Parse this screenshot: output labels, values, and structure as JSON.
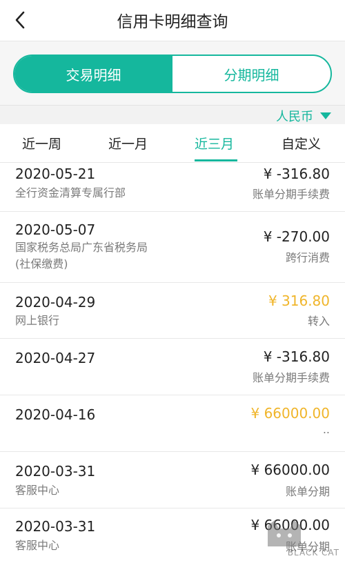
{
  "header": {
    "title": "信用卡明细查询",
    "back_icon": "back-arrow-icon"
  },
  "segments": [
    {
      "label": "交易明细",
      "active": true
    },
    {
      "label": "分期明细",
      "active": false
    }
  ],
  "currency": {
    "label": "人民币",
    "icon": "caret-down-icon"
  },
  "tabs": [
    {
      "label": "近一周",
      "active": false
    },
    {
      "label": "近一月",
      "active": false
    },
    {
      "label": "近三月",
      "active": true
    },
    {
      "label": "自定义",
      "active": false
    }
  ],
  "transactions": [
    {
      "date": "2020-05-21",
      "desc": "全行资金清算专属行部",
      "amount": "¥ -316.80",
      "type": "账单分期手续费"
    },
    {
      "date": "2020-05-07",
      "desc": "国家税务总局广东省税务局\n(社保缴费)",
      "amount": "¥ -270.00",
      "type": "跨行消费"
    },
    {
      "date": "2020-04-29",
      "desc": "网上银行",
      "amount": "¥ 316.80",
      "type": "转入"
    },
    {
      "date": "2020-04-27",
      "desc": "",
      "amount": "¥ -316.80",
      "type": "账单分期手续费"
    },
    {
      "date": "2020-04-16",
      "desc": "",
      "amount": "¥ 66000.00",
      "type": ".."
    },
    {
      "date": "2020-03-31",
      "desc": "客服中心",
      "amount": "¥ 66000.00",
      "type": "账单分期"
    },
    {
      "date": "2020-03-31",
      "desc": "客服中心",
      "amount": "¥ 66000.00",
      "type": "账单分期"
    }
  ],
  "watermark": {
    "text": "BLACK CAT"
  },
  "colors": {
    "accent": "#15b79d",
    "income": "#f0b52a"
  }
}
